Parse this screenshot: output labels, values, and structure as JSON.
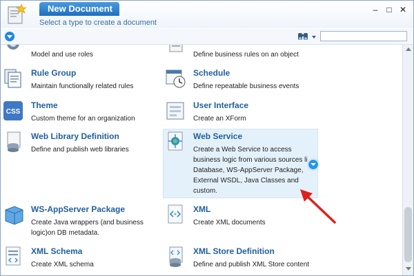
{
  "header": {
    "title": "New Document",
    "subtitle": "Select a type to create a document",
    "controls": {
      "minimize": "–",
      "maximize": "□",
      "close": "✕"
    }
  },
  "toolbar": {
    "search_value": ""
  },
  "items": [
    {
      "id": "roles",
      "title": "",
      "desc": "Model and use roles",
      "icon": "roles-icon"
    },
    {
      "id": "rules",
      "title": "",
      "desc": "Define business rules on an object",
      "icon": "rule-icon"
    },
    {
      "id": "rule-group",
      "title": "Rule Group",
      "desc": "Maintain functionally related rules",
      "icon": "rule-group-icon"
    },
    {
      "id": "schedule",
      "title": "Schedule",
      "desc": "Define repeatable business events",
      "icon": "schedule-icon"
    },
    {
      "id": "theme",
      "title": "Theme",
      "desc": "Custom theme for an organization",
      "icon": "css-icon",
      "icon_text": "CSS"
    },
    {
      "id": "user-interface",
      "title": "User Interface",
      "desc": "Create an XForm",
      "icon": "user-interface-icon"
    },
    {
      "id": "web-library",
      "title": "Web Library Definition",
      "desc": "Define and publish web libraries",
      "icon": "web-library-icon"
    },
    {
      "id": "web-service",
      "title": "Web Service",
      "desc_lines": [
        "Create a Web Service to access",
        "business logic from various sources li",
        "Database, WS-AppServer Package,",
        "External WSDL, Java Classes and",
        "custom."
      ],
      "icon": "web-service-icon"
    },
    {
      "id": "ws-appserver",
      "title": "WS-AppServer Package",
      "desc_lines": [
        "Create Java wrappers (and business",
        "logic)on DB metadata."
      ],
      "icon": "package-icon"
    },
    {
      "id": "xml",
      "title": "XML",
      "desc": "Create XML documents",
      "icon": "xml-icon"
    },
    {
      "id": "xml-schema",
      "title": "XML Schema",
      "desc": "Create XML schema",
      "icon": "xml-schema-icon"
    },
    {
      "id": "xml-store",
      "title": "XML Store Definition",
      "desc": "Define and publish XML Store content",
      "icon": "xml-store-icon"
    }
  ],
  "colors": {
    "accent": "#1f6fc0",
    "title_text": "#1f5fa0",
    "highlight": "#e5f1fa",
    "annotation_arrow": "#e0201c"
  }
}
